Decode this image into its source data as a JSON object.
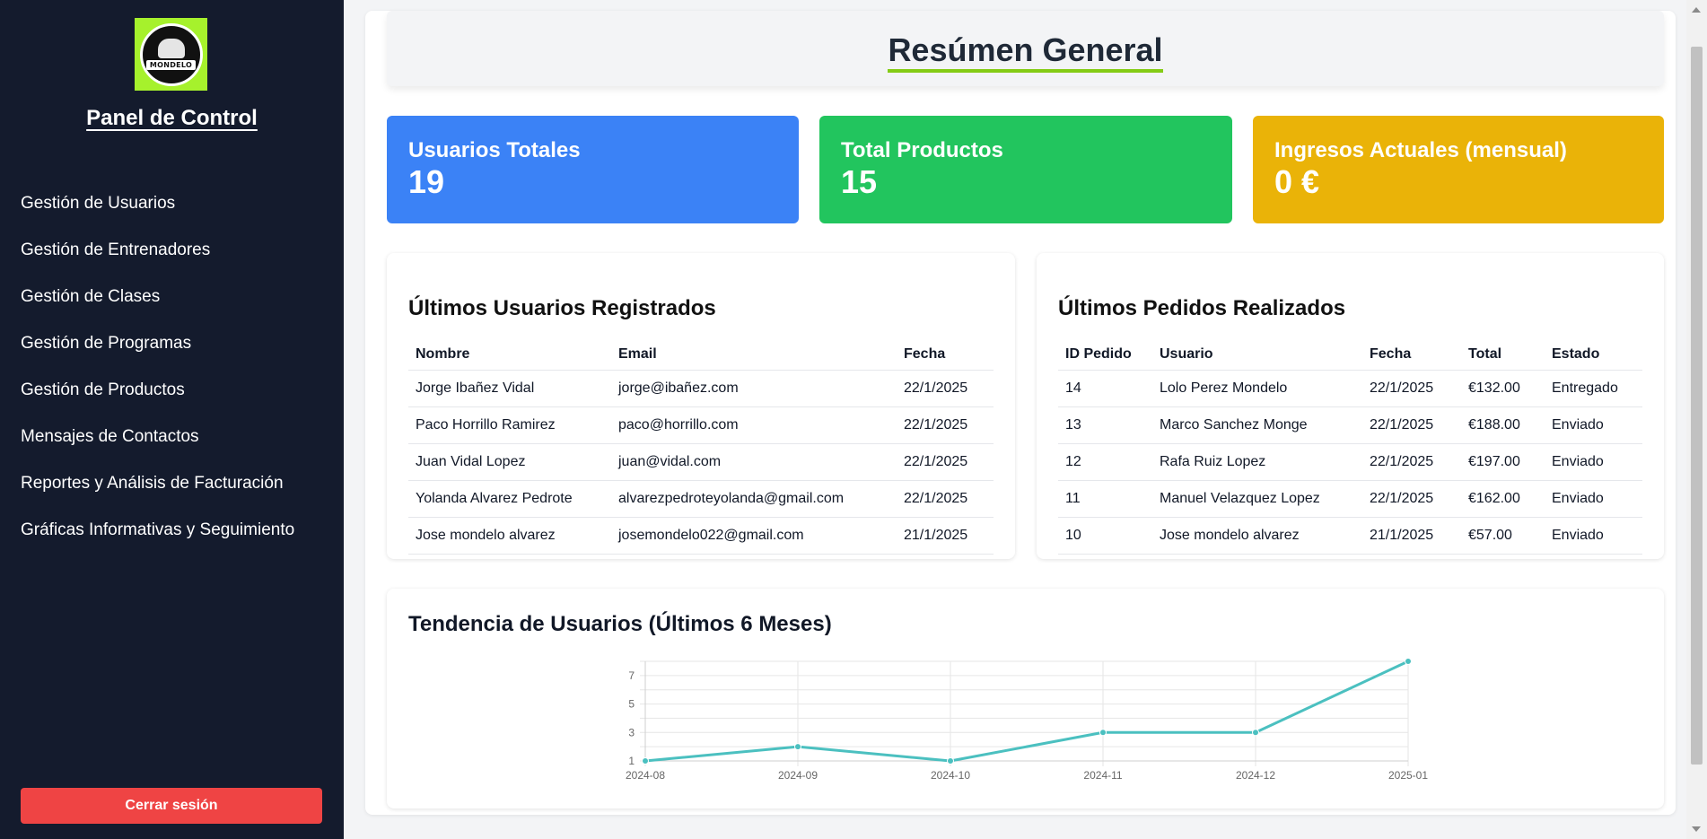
{
  "sidebar": {
    "logo_text": "MONDELO",
    "title": "Panel de Control",
    "items": [
      {
        "label": "Gestión de Usuarios"
      },
      {
        "label": "Gestión de Entrenadores"
      },
      {
        "label": "Gestión de Clases"
      },
      {
        "label": "Gestión de Programas"
      },
      {
        "label": "Gestión de Productos"
      },
      {
        "label": "Mensajes de Contactos"
      },
      {
        "label": "Reportes y Análisis de Facturación"
      },
      {
        "label": "Gráficas Informativas y Seguimiento"
      }
    ],
    "logout_label": "Cerrar sesión"
  },
  "header": {
    "title": "Resúmen General"
  },
  "stats": [
    {
      "label": "Usuarios Totales",
      "value": "19",
      "color": "#3b82f6"
    },
    {
      "label": "Total Productos",
      "value": "15",
      "color": "#22c55e"
    },
    {
      "label": "Ingresos Actuales (mensual)",
      "value": "0 €",
      "color": "#eab308"
    }
  ],
  "latest_users": {
    "title": "Últimos Usuarios Registrados",
    "columns": [
      "Nombre",
      "Email",
      "Fecha"
    ],
    "rows": [
      [
        "Jorge Ibañez Vidal",
        "jorge@ibañez.com",
        "22/1/2025"
      ],
      [
        "Paco Horrillo Ramirez",
        "paco@horrillo.com",
        "22/1/2025"
      ],
      [
        "Juan Vidal Lopez",
        "juan@vidal.com",
        "22/1/2025"
      ],
      [
        "Yolanda Alvarez Pedrote",
        "alvarezpedroteyolanda@gmail.com",
        "22/1/2025"
      ],
      [
        "Jose mondelo alvarez",
        "josemondelo022@gmail.com",
        "21/1/2025"
      ]
    ]
  },
  "latest_orders": {
    "title": "Últimos Pedidos Realizados",
    "columns": [
      "ID Pedido",
      "Usuario",
      "Fecha",
      "Total",
      "Estado"
    ],
    "rows": [
      [
        "14",
        "Lolo Perez Mondelo",
        "22/1/2025",
        "€132.00",
        "Entregado"
      ],
      [
        "13",
        "Marco Sanchez Monge",
        "22/1/2025",
        "€188.00",
        "Enviado"
      ],
      [
        "12",
        "Rafa Ruiz Lopez",
        "22/1/2025",
        "€197.00",
        "Enviado"
      ],
      [
        "11",
        "Manuel Velazquez Lopez",
        "22/1/2025",
        "€162.00",
        "Enviado"
      ],
      [
        "10",
        "Jose mondelo alvarez",
        "21/1/2025",
        "€57.00",
        "Enviado"
      ]
    ]
  },
  "chart_title": "Tendencia de Usuarios (Últimos 6 Meses)",
  "chart_data": {
    "type": "line",
    "title": "",
    "xlabel": "",
    "ylabel": "",
    "categories": [
      "2024-08",
      "2024-09",
      "2024-10",
      "2024-11",
      "2024-12",
      "2025-01"
    ],
    "series": [
      {
        "values": [
          1,
          2,
          1,
          3,
          3,
          8
        ],
        "color": "#4bc0c0"
      }
    ],
    "ylim": [
      1,
      8
    ],
    "yticks": [
      "1",
      "3",
      "5",
      "7"
    ],
    "grid": true
  }
}
